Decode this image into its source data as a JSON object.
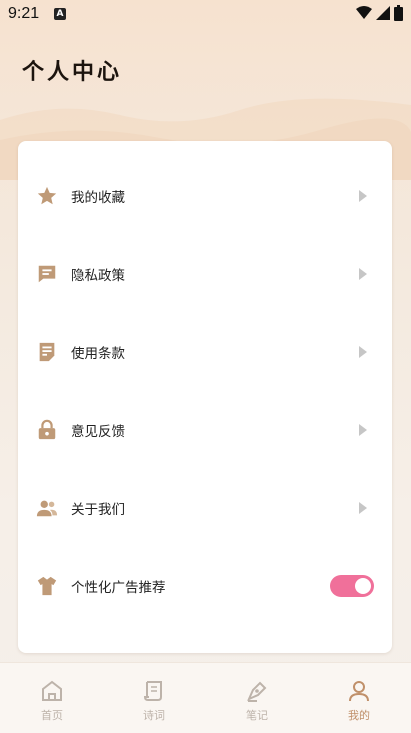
{
  "status_bar": {
    "time": "9:21",
    "app_icon_label": "A"
  },
  "page": {
    "title": "个人中心"
  },
  "menu": {
    "items": [
      {
        "label": "我的收藏",
        "icon": "star-icon"
      },
      {
        "label": "隐私政策",
        "icon": "chat-icon"
      },
      {
        "label": "使用条款",
        "icon": "document-icon"
      },
      {
        "label": "意见反馈",
        "icon": "lock-icon"
      },
      {
        "label": "关于我们",
        "icon": "people-icon"
      }
    ],
    "toggle_item": {
      "label": "个性化广告推荐",
      "icon": "shirt-icon",
      "enabled": true
    }
  },
  "tabbar": {
    "tabs": [
      {
        "label": "首页",
        "icon": "home-icon"
      },
      {
        "label": "诗词",
        "icon": "scroll-icon"
      },
      {
        "label": "笔记",
        "icon": "pen-icon"
      },
      {
        "label": "我的",
        "icon": "user-icon",
        "active": true
      }
    ]
  },
  "colors": {
    "accent": "#c0906a",
    "toggle_on": "#f0709a",
    "icon": "#bf9a77"
  }
}
